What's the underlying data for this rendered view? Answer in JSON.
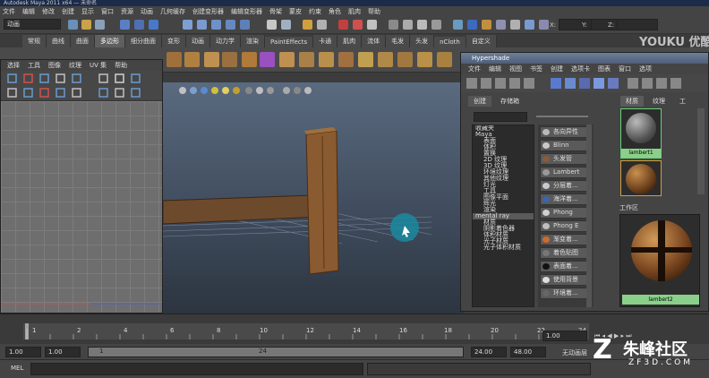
{
  "window": {
    "title": "Autodesk Maya 2011 x64 — 未命名"
  },
  "menubar": {
    "items": [
      "文件",
      "编辑",
      "修改",
      "创建",
      "显示",
      "窗口",
      "资源",
      "动画",
      "几何缓存",
      "创建变形器",
      "编辑变形器",
      "骨架",
      "蒙皮",
      "约束",
      "角色",
      "肌肉",
      "帮助"
    ]
  },
  "status": {
    "mode": "动画",
    "coords": [
      "X:",
      "Y:",
      "Z:"
    ]
  },
  "shelf_tabs": [
    "常规",
    "曲线",
    "曲面",
    "多边形",
    "细分曲面",
    "变形",
    "动画",
    "动力学",
    "渲染",
    "PaintEffects",
    "卡通",
    "肌肉",
    "流体",
    "毛发",
    "头发",
    "nCloth",
    "自定义"
  ],
  "active_shelf_tab": "多边形",
  "uv_editor": {
    "menu": [
      "选择",
      "工具",
      "图像",
      "纹理",
      "UV 集",
      "帮助"
    ]
  },
  "hypershade": {
    "title": "Hypershade",
    "menu": [
      "文件",
      "编辑",
      "视图",
      "书签",
      "创建",
      "选项卡",
      "图表",
      "窗口",
      "选项"
    ],
    "tabs": [
      "创建",
      "存储箱"
    ],
    "right_tabs": [
      "材质",
      "纹理",
      "工"
    ],
    "tree": [
      {
        "label": "收藏夹",
        "header": true
      },
      {
        "label": "Maya",
        "header": true
      },
      {
        "label": "表面"
      },
      {
        "label": "体积"
      },
      {
        "label": "置换"
      },
      {
        "label": "2D 纹理"
      },
      {
        "label": "3D 纹理"
      },
      {
        "label": "环境纹理"
      },
      {
        "label": "其他纹理"
      },
      {
        "label": "灯光"
      },
      {
        "label": "工具"
      },
      {
        "label": "图像平面"
      },
      {
        "label": "辉光"
      },
      {
        "label": "渲染"
      },
      {
        "label": "mental ray",
        "header": true,
        "selected": true
      },
      {
        "label": "材质"
      },
      {
        "label": "阴影着色器"
      },
      {
        "label": "体积材质"
      },
      {
        "label": "光子材质"
      },
      {
        "label": "光子体积材质"
      }
    ],
    "nodes": [
      {
        "label": "各向异性",
        "color": "#b9b9b9"
      },
      {
        "label": "Blinn",
        "color": "#c9c9c9"
      },
      {
        "label": "头发管",
        "color": "#8a5a3a"
      },
      {
        "label": "Lambert",
        "color": "#999999"
      },
      {
        "label": "分层着...",
        "color": "#c9c9d0"
      },
      {
        "label": "海洋着...",
        "color": "#3a66aa"
      },
      {
        "label": "Phong",
        "color": "#cfcfcf"
      },
      {
        "label": "Phong E",
        "color": "#bebebe"
      },
      {
        "label": "渐变着...",
        "color": "#d26a2a"
      },
      {
        "label": "着色贴图",
        "color": "#777777"
      },
      {
        "label": "表面着...",
        "color": "#111111"
      },
      {
        "label": "使用背景",
        "color": "#dddddd"
      },
      {
        "label": "环境着...",
        "color": "#666666"
      }
    ],
    "swatches": [
      "lambert1"
    ],
    "work_title": "工作区",
    "work_swatch": "lambert2"
  },
  "timeline": {
    "ticks": [
      "1",
      "2",
      "4",
      "6",
      "8",
      "10",
      "12",
      "14",
      "16",
      "18",
      "20",
      "22",
      "24"
    ],
    "current_frame": "1.00",
    "range_start": "1.00",
    "range_start2": "1.00",
    "range_end": "24.00",
    "range_end2": "48.00",
    "slider_start": "1",
    "slider_end": "24",
    "auto_key": "无动画层"
  },
  "cmdline": {
    "label": "MEL"
  },
  "watermarks": {
    "youku": "YOUKU 优酷",
    "zf3d": "朱峰社区",
    "zf3d_url": "ZF3D.COM"
  }
}
